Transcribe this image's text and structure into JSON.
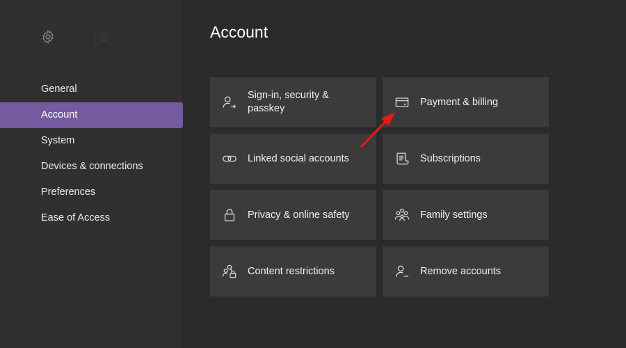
{
  "sidebar": {
    "items": [
      {
        "label": "General",
        "active": false
      },
      {
        "label": "Account",
        "active": true
      },
      {
        "label": "System",
        "active": false
      },
      {
        "label": "Devices & connections",
        "active": false
      },
      {
        "label": "Preferences",
        "active": false
      },
      {
        "label": "Ease of Access",
        "active": false
      }
    ],
    "header_icon": "gear-icon"
  },
  "main": {
    "title": "Account",
    "tiles": [
      {
        "label": "Sign-in, security & passkey",
        "icon": "person-signin-icon"
      },
      {
        "label": "Payment & billing",
        "icon": "credit-card-icon"
      },
      {
        "label": "Linked social accounts",
        "icon": "link-icon"
      },
      {
        "label": "Subscriptions",
        "icon": "receipt-icon"
      },
      {
        "label": "Privacy & online safety",
        "icon": "lock-icon"
      },
      {
        "label": "Family settings",
        "icon": "family-icon"
      },
      {
        "label": "Content restrictions",
        "icon": "people-lock-icon"
      },
      {
        "label": "Remove accounts",
        "icon": "person-remove-icon"
      }
    ]
  },
  "colors": {
    "background": "#2b2b2b",
    "sidebar": "#303030",
    "accent": "#745a9e",
    "tile": "#3b3b3b",
    "annotation_arrow": "#e3191c"
  }
}
